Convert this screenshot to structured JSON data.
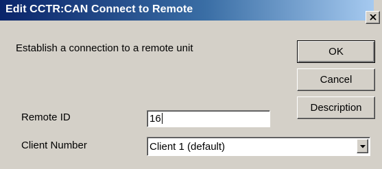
{
  "window": {
    "title": "Edit CCTR:CAN Connect to Remote",
    "close_icon": "close-x-icon"
  },
  "description": "Establish a connection to a remote unit",
  "buttons": {
    "ok": "OK",
    "cancel": "Cancel",
    "description": "Description"
  },
  "fields": {
    "remote_id": {
      "label": "Remote ID",
      "value": "16"
    },
    "client_number": {
      "label": "Client Number",
      "selected": "Client 1 (default)",
      "dropdown_icon": "chevron-down-icon"
    }
  },
  "colors": {
    "dialog_face": "#d4d0c8",
    "title_start": "#0a246a",
    "title_end": "#a6caf0"
  }
}
